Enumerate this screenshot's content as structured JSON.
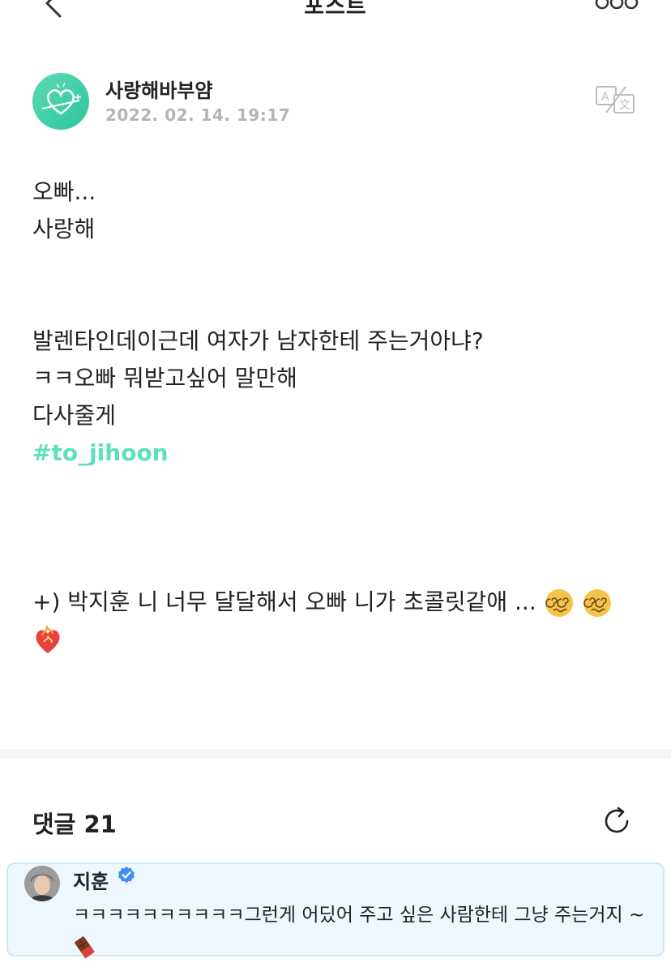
{
  "header": {
    "title": "포스트",
    "back_icon": "chevron-left-icon",
    "more_icon": "more-options-icon"
  },
  "author": {
    "name": "사랑해바부얌",
    "date": "2022. 02. 14. 19:17",
    "avatar_color": "#3ccca4",
    "translate_icon": "translate-icon"
  },
  "post": {
    "lines": [
      "오빠...",
      "사랑해",
      "",
      "",
      "발렌타인데이근데 여자가 남자한테 주는거아냐?",
      "ㅋㅋ오빠 뭐받고싶어 말만해",
      "다사줄게"
    ],
    "hashtag": "#to_jihoon",
    "ps_text": "+) 박지훈 니 너무 달달해서 오빠 니가 초콜릿같애 ...",
    "ps_emojis": [
      "dizzy-face-icon",
      "dizzy-face-icon",
      "heart-on-fire-icon"
    ],
    "hashtag_color": "#5fe0bd"
  },
  "comments": {
    "title": "댓글 21",
    "refresh_icon": "refresh-icon",
    "items": [
      {
        "name": "지훈",
        "verified": true,
        "text": "ㅋㅋㅋㅋㅋㅋㅋㅋㅋㅋ그런게 어딨어 주고 싶은 사람한테 그냥 주는거지 ~",
        "emoji": "chocolate-bar-icon",
        "highlight_bg": "#eef7fd"
      }
    ]
  }
}
